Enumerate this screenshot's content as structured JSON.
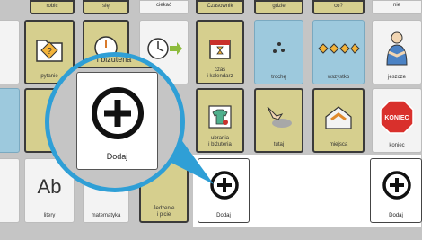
{
  "top_row": [
    "robić",
    "się",
    "ciekać",
    "Czasownik",
    "gdzie",
    "co?",
    "nie"
  ],
  "tiles": {
    "pytanie": "pytanie",
    "bizuteria_strip": "i biżuteria",
    "czas": "czas\ni kalendarz",
    "troche": "trochę",
    "wszystko": "wszystko",
    "jeszcze": "jeszcze",
    "ubrania": "ubrania\ni biżuteria",
    "tutaj": "tutaj",
    "miejsca": "miejsca",
    "koniec": "koniec",
    "koniec_sign": "KONIEC",
    "litery": "litery",
    "matematyka": "matematyka",
    "jedzenie": "Jedzenie\ni picie",
    "letters": "Ab"
  },
  "add_label": "Dodaj",
  "magnifier_label": "Dodaj",
  "colors": {
    "accent": "#2f9fd6",
    "yellow_tile": "#d6cf8e",
    "blue_tile": "#9dc9dd",
    "stop": "#d9302c"
  },
  "icons": [
    "question-icon",
    "clock-icon",
    "calendar-icon",
    "dots-icon",
    "eyes-icon",
    "person-icon",
    "clothes-icon",
    "hand-icon",
    "house-icon",
    "stop-sign-icon",
    "plus-circle-icon"
  ]
}
